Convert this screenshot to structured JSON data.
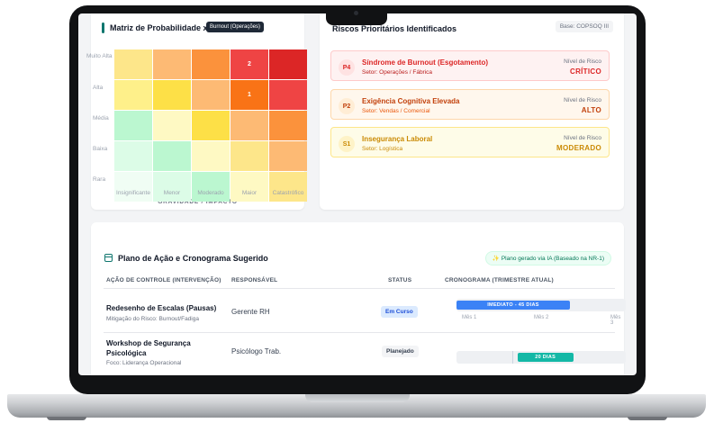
{
  "matrix": {
    "title": "Matriz de Probabilidade x",
    "tooltip": "Burnout (Operações)",
    "rows": [
      "Muito Alta",
      "Alta",
      "Média",
      "Baixa",
      "Rara"
    ],
    "cols": [
      "Insignificante",
      "Menor",
      "Moderado",
      "Maior",
      "Catastrófico"
    ],
    "axis_title": "GRAVIDADE / IMPACTO",
    "cells": [
      [
        {
          "color": "#fde68a",
          "label": ""
        },
        {
          "color": "#fdba74",
          "label": ""
        },
        {
          "color": "#fb923c",
          "label": ""
        },
        {
          "color": "#ef4444",
          "label": "2"
        },
        {
          "color": "#dc2626",
          "label": ""
        }
      ],
      [
        {
          "color": "#fef08a",
          "label": ""
        },
        {
          "color": "#fde047",
          "label": ""
        },
        {
          "color": "#fdba74",
          "label": ""
        },
        {
          "color": "#f97316",
          "label": "1"
        },
        {
          "color": "#ef4444",
          "label": ""
        }
      ],
      [
        {
          "color": "#bbf7d0",
          "label": ""
        },
        {
          "color": "#fef9c3",
          "label": ""
        },
        {
          "color": "#fde047",
          "label": ""
        },
        {
          "color": "#fdba74",
          "label": ""
        },
        {
          "color": "#fb923c",
          "label": ""
        }
      ],
      [
        {
          "color": "#dcfce7",
          "label": ""
        },
        {
          "color": "#bbf7d0",
          "label": ""
        },
        {
          "color": "#fef9c3",
          "label": ""
        },
        {
          "color": "#fde68a",
          "label": ""
        },
        {
          "color": "#fdba74",
          "label": ""
        }
      ],
      [
        {
          "color": "#f0fdf4",
          "label": ""
        },
        {
          "color": "#dcfce7",
          "label": ""
        },
        {
          "color": "#bbf7d0",
          "label": ""
        },
        {
          "color": "#fef9c3",
          "label": ""
        },
        {
          "color": "#fde68a",
          "label": ""
        }
      ]
    ]
  },
  "risks": {
    "title": "Riscos Prioritários Identificados",
    "base_badge": "Base: COPSOQ III",
    "level_label": "Nível de Risco",
    "items": [
      {
        "code": "P4",
        "name": "Síndrome de Burnout (Esgotamento)",
        "sector": "Setor: Operações / Fábrica",
        "level": "CRÍTICO",
        "bg": "#fef2f2",
        "border": "#fecaca",
        "badge_bg": "#fee2e2",
        "accent": "#dc2626",
        "sub": "#b91c1c"
      },
      {
        "code": "P2",
        "name": "Exigência Cognitiva Elevada",
        "sector": "Setor: Vendas / Comercial",
        "level": "ALTO",
        "bg": "#fff7ed",
        "border": "#fed7aa",
        "badge_bg": "#ffedd5",
        "accent": "#c2410c",
        "sub": "#ea580c"
      },
      {
        "code": "S1",
        "name": "Insegurança Laboral",
        "sector": "Setor: Logística",
        "level": "MODERADO",
        "bg": "#fefce8",
        "border": "#fde68a",
        "badge_bg": "#fef3c7",
        "accent": "#ca8a04",
        "sub": "#ca8a04"
      }
    ]
  },
  "plan": {
    "title": "Plano de Ação e Cronograma Sugerido",
    "ia_badge": "✨ Plano gerado via IA (Baseado na NR-1)",
    "headers": {
      "action": "AÇÃO DE CONTROLE (INTERVENÇÃO)",
      "owner": "RESPONSÁVEL",
      "status": "STATUS",
      "schedule": "CRONOGRAMA (TRIMESTRE ATUAL)"
    },
    "rows": [
      {
        "name": "Redesenho de Escalas (Pausas)",
        "sub": "Mitigação do Risco: Burnout/Fadiga",
        "owner": "Gerente RH",
        "status": "Em Curso",
        "status_bg": "#dbeafe",
        "status_fg": "#1d4ed8",
        "bar_label": "IMEDIATO - 45 DIAS",
        "bar_color": "#3b82f6",
        "bar_start": 0,
        "bar_end": 0.67
      },
      {
        "name": "Workshop de Segurança Psicológica",
        "sub": "Foco: Liderança Operacional",
        "owner": "Psicólogo Trab.",
        "status": "Planejado",
        "status_bg": "#f3f4f6",
        "status_fg": "#374151",
        "bar_label": "20 DIAS",
        "bar_color": "#14b8a6",
        "bar_start": 0.36,
        "bar_end": 0.69
      }
    ],
    "months": [
      "Mês 1",
      "Mês 2",
      "Mês 3"
    ]
  }
}
